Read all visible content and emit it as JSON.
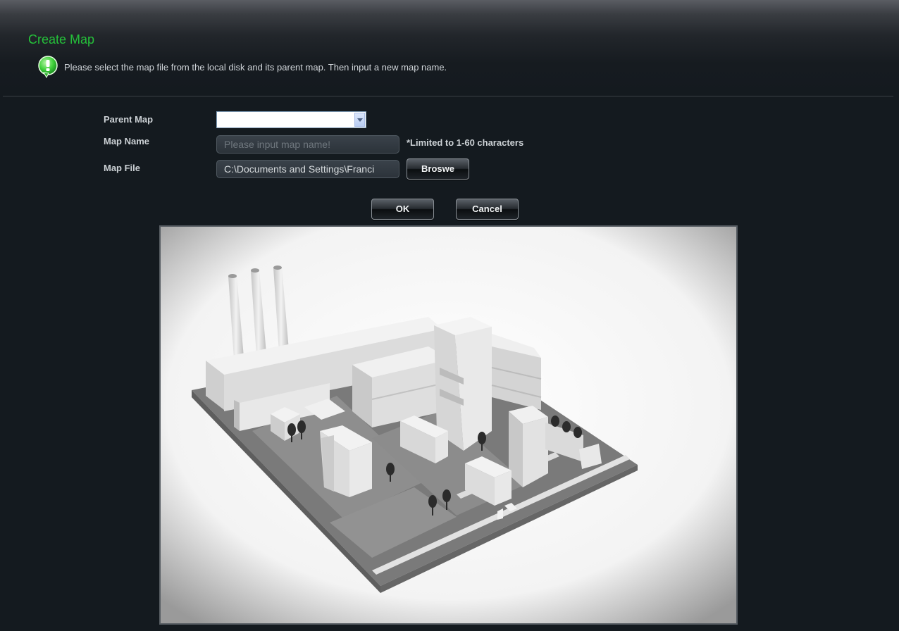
{
  "header": {
    "title": "Create Map",
    "info_text": "Please select the map file from the local disk and its parent map. Then input a new map name.",
    "info_icon": "info-bubble-icon"
  },
  "form": {
    "parent_map": {
      "label": "Parent Map",
      "value": ""
    },
    "map_name": {
      "label": "Map Name",
      "placeholder": "Please input map name!",
      "value": "",
      "hint": "*Limited to 1-60 characters"
    },
    "map_file": {
      "label": "Map File",
      "value": "C:\\Documents and Settings\\Franci",
      "browse_label": "Broswe"
    }
  },
  "actions": {
    "ok_label": "OK",
    "cancel_label": "Cancel"
  },
  "colors": {
    "accent": "#25c13a",
    "background": "#141a1f"
  }
}
